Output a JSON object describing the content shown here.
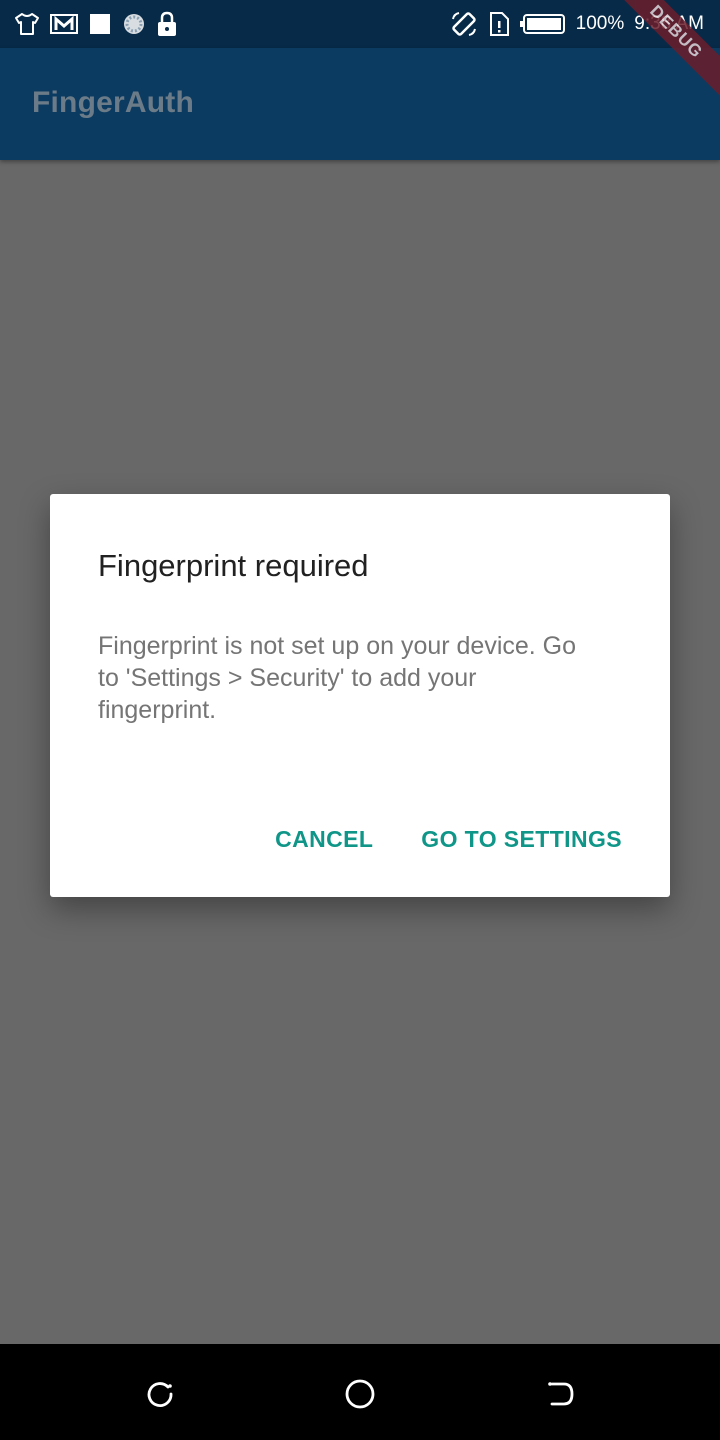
{
  "status_bar": {
    "battery_percent": "100%",
    "time": "9:38 AM",
    "left_icons": [
      "shirt-icon",
      "gmail-icon",
      "square-notification-icon",
      "loading-circle-icon",
      "lock-icon"
    ],
    "right_icons": [
      "rotate-screen-icon",
      "sim-card-icon",
      "battery-icon"
    ]
  },
  "app_bar": {
    "title": "FingerAuth",
    "debug_banner": "DEBUG"
  },
  "dialog": {
    "title": "Fingerprint required",
    "message": "Fingerprint is not set up on your device. Go to 'Settings > Security' to add your fingerprint.",
    "cancel_label": "CANCEL",
    "settings_label": "GO TO SETTINGS",
    "accent_color": "#0f9688"
  },
  "nav_bar": {
    "buttons": [
      "recents-icon",
      "home-icon",
      "back-icon"
    ]
  }
}
